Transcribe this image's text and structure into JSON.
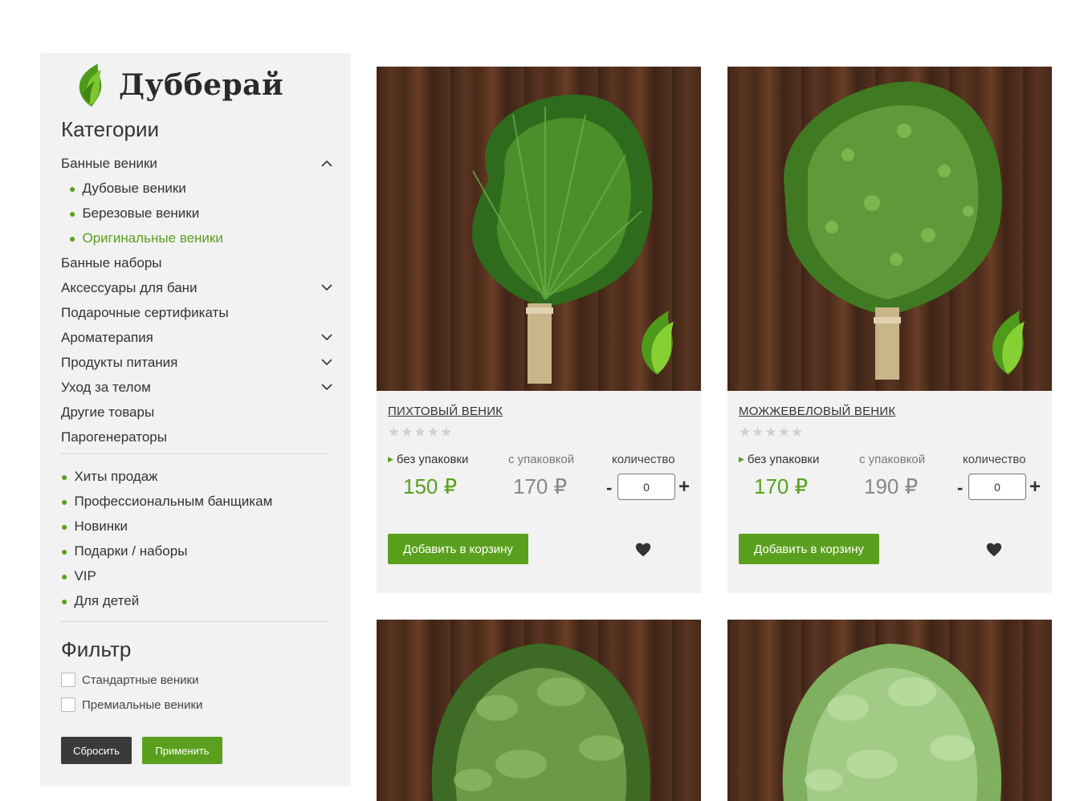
{
  "brand": {
    "name": "Дубберай",
    "logo_icon": "leaf-icon"
  },
  "sidebar": {
    "categories_title": "Категории",
    "categories": [
      {
        "label": "Банные веники",
        "expanded": true,
        "has_children": true,
        "children": [
          {
            "label": "Дубовые веники",
            "active": false
          },
          {
            "label": "Березовые веники",
            "active": false
          },
          {
            "label": "Оригинальные веники",
            "active": true
          }
        ]
      },
      {
        "label": "Банные наборы",
        "has_children": false
      },
      {
        "label": "Аксессуары для бани",
        "has_children": true
      },
      {
        "label": "Подарочные сертификаты",
        "has_children": false
      },
      {
        "label": "Ароматерапия",
        "has_children": true
      },
      {
        "label": "Продукты питания",
        "has_children": true
      },
      {
        "label": "Уход за телом",
        "has_children": true
      },
      {
        "label": "Другие товары",
        "has_children": false
      },
      {
        "label": "Парогенераторы",
        "has_children": false
      }
    ],
    "tags": [
      "Хиты продаж",
      "Профессиональным банщикам",
      "Новинки",
      "Подарки / наборы",
      "VIP",
      "Для детей"
    ],
    "filter_title": "Фильтр",
    "filters": [
      {
        "label": "Стандартные веники",
        "checked": false
      },
      {
        "label": "Премиальные веники",
        "checked": false
      }
    ],
    "reset_label": "Сбросить",
    "apply_label": "Применить"
  },
  "products": [
    {
      "title": "ПИХТОВЫЙ ВЕНИК",
      "rating": 0,
      "stars": "★★★★★",
      "opt_nopack": "без упаковки",
      "opt_pack": "с упаковкой",
      "opt_qty": "количество",
      "price_nopack": "150 ₽",
      "price_pack": "170 ₽",
      "quantity": "0",
      "minus": "-",
      "plus": "+",
      "cart_label": "Добавить в корзину"
    },
    {
      "title": "МОЖЖЕВЕЛОВЫЙ ВЕНИК",
      "rating": 0,
      "stars": "★★★★★",
      "opt_nopack": "без упаковки",
      "opt_pack": "с упаковкой",
      "opt_qty": "количество",
      "price_nopack": "170 ₽",
      "price_pack": "190 ₽",
      "quantity": "0",
      "minus": "-",
      "plus": "+",
      "cart_label": "Добавить в корзину"
    }
  ],
  "colors": {
    "accent": "#5aa01e",
    "dark_button": "#3a3a3a",
    "panel_bg": "#f2f2f2"
  }
}
